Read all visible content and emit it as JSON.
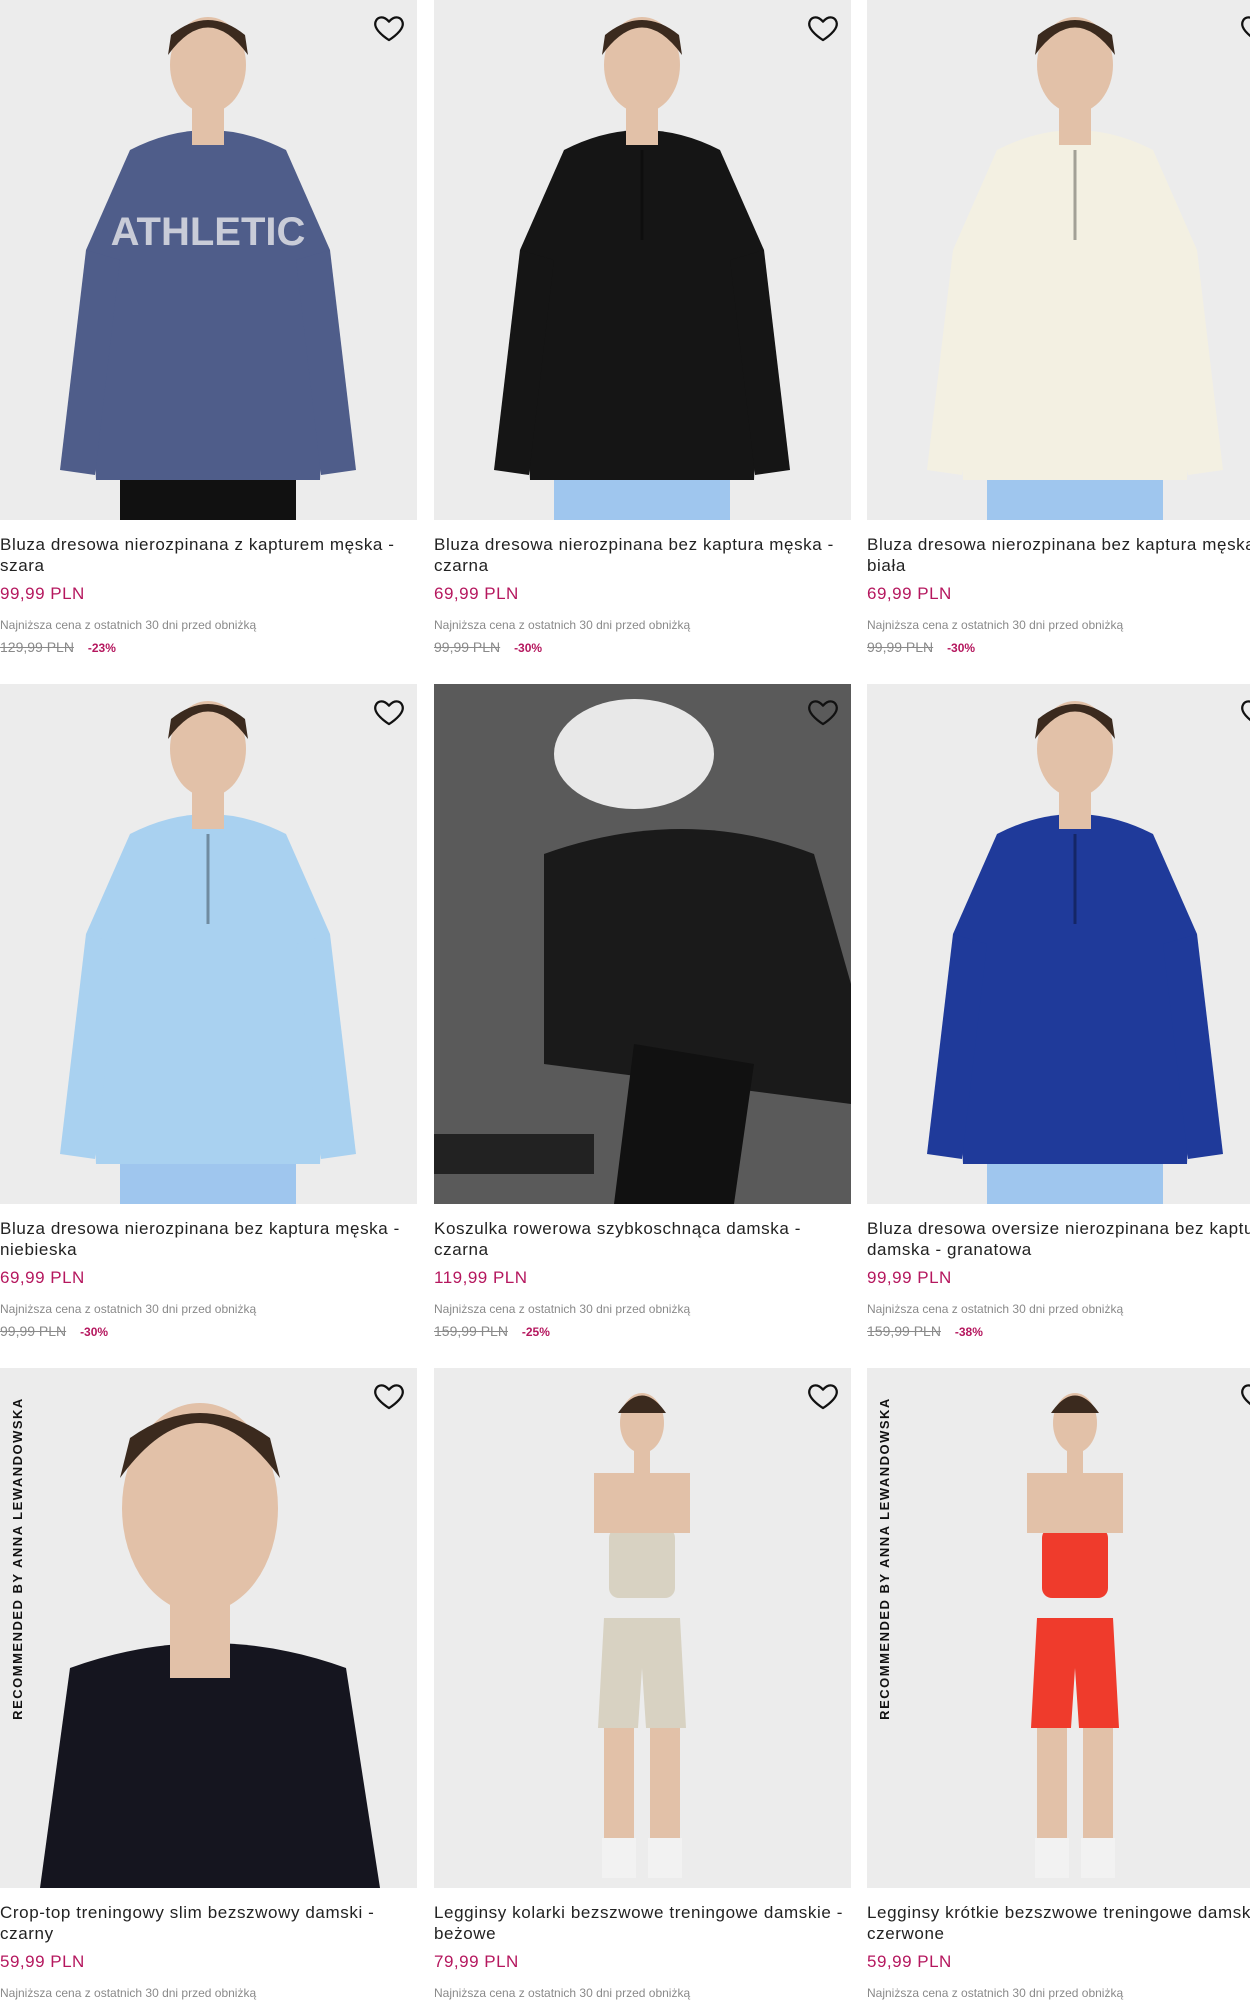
{
  "colors": {
    "price": "#b5175e",
    "muted": "#8a8a8a",
    "image_bg": "#ececec"
  },
  "products": [
    {
      "title": "Bluza dresowa nierozpinana z kapturem męska - szara",
      "price": "99,99 PLN",
      "lowest_label": "Najniższa cena z ostatnich 30 dni przed obniżką",
      "old_price": "129,99 PLN",
      "discount": "-23%",
      "image_icon": "hoodie-image",
      "garment_color": "#4f5d8a",
      "badge": ""
    },
    {
      "title": "Bluza dresowa nierozpinana bez kaptura męska - czarna",
      "price": "69,99 PLN",
      "lowest_label": "Najniższa cena z ostatnich 30 dni przed obniżką",
      "old_price": "99,99 PLN",
      "discount": "-30%",
      "image_icon": "sweatshirt-image",
      "garment_color": "#151515",
      "badge": ""
    },
    {
      "title": "Bluza dresowa nierozpinana bez kaptura męska - biała",
      "price": "69,99 PLN",
      "lowest_label": "Najniższa cena z ostatnich 30 dni przed obniżką",
      "old_price": "99,99 PLN",
      "discount": "-30%",
      "image_icon": "sweatshirt-image",
      "garment_color": "#f3f0e2",
      "badge": ""
    },
    {
      "title": "Bluza dresowa nierozpinana bez kaptura męska - niebieska",
      "price": "69,99 PLN",
      "lowest_label": "Najniższa cena z ostatnich 30 dni przed obniżką",
      "old_price": "99,99 PLN",
      "discount": "-30%",
      "image_icon": "sweatshirt-image",
      "garment_color": "#a9d1f0",
      "badge": ""
    },
    {
      "title": "Koszulka rowerowa szybkoschnąca damska - czarna",
      "price": "119,99 PLN",
      "lowest_label": "Najniższa cena z ostatnich 30 dni przed obniżką",
      "old_price": "159,99 PLN",
      "discount": "-25%",
      "image_icon": "cycling-shirt-image",
      "garment_color": "#1a1a1a",
      "badge": ""
    },
    {
      "title": "Bluza dresowa oversize nierozpinana bez kaptura damska - granatowa",
      "price": "99,99 PLN",
      "lowest_label": "Najniższa cena z ostatnich 30 dni przed obniżką",
      "old_price": "159,99 PLN",
      "discount": "-38%",
      "image_icon": "sweatshirt-image",
      "garment_color": "#1f3a9a",
      "badge": ""
    },
    {
      "title": "Crop-top treningowy slim bezszwowy damski - czarny",
      "price": "59,99 PLN",
      "lowest_label": "Najniższa cena z ostatnich 30 dni przed obniżką",
      "old_price": "",
      "discount": "",
      "image_icon": "crop-top-image",
      "garment_color": "#15151f",
      "badge": "RECOMMENDED BY ANNA LEWANDOWSKA"
    },
    {
      "title": "Legginsy kolarki bezszwowe treningowe damskie - beżowe",
      "price": "79,99 PLN",
      "lowest_label": "Najniższa cena z ostatnich 30 dni przed obniżką",
      "old_price": "",
      "discount": "",
      "image_icon": "leggings-image",
      "garment_color": "#d8d2c2",
      "badge": ""
    },
    {
      "title": "Legginsy krótkie bezszwowe treningowe damskie - czerwone",
      "price": "59,99 PLN",
      "lowest_label": "Najniższa cena z ostatnich 30 dni przed obniżką",
      "old_price": "",
      "discount": "",
      "image_icon": "leggings-image",
      "garment_color": "#ef3b2c",
      "badge": "RECOMMENDED BY ANNA LEWANDOWSKA"
    }
  ]
}
